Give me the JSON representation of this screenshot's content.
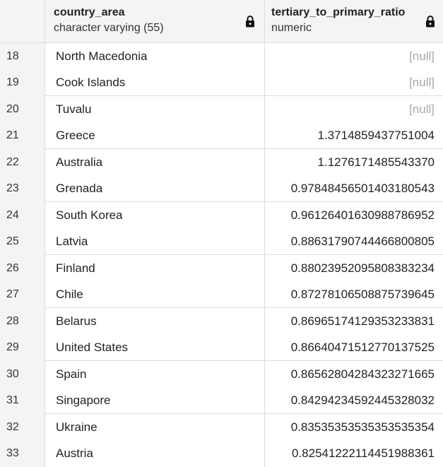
{
  "columns": [
    {
      "name": "country_area",
      "type": "character varying (55)",
      "icon": "lock-icon"
    },
    {
      "name": "tertiary_to_primary_ratio",
      "type": "numeric",
      "icon": "lock-icon"
    }
  ],
  "rows": [
    {
      "n": "18",
      "country": "North Macedonia",
      "ratio": "[null]",
      "is_null": true
    },
    {
      "n": "19",
      "country": "Cook Islands",
      "ratio": "[null]",
      "is_null": true
    },
    {
      "n": "20",
      "country": "Tuvalu",
      "ratio": "[null]",
      "is_null": true
    },
    {
      "n": "21",
      "country": "Greece",
      "ratio": "1.3714859437751004",
      "is_null": false
    },
    {
      "n": "22",
      "country": "Australia",
      "ratio": "1.1276171485543370",
      "is_null": false
    },
    {
      "n": "23",
      "country": "Grenada",
      "ratio": "0.97848456501403180543",
      "is_null": false
    },
    {
      "n": "24",
      "country": "South Korea",
      "ratio": "0.96126401630988786952",
      "is_null": false
    },
    {
      "n": "25",
      "country": "Latvia",
      "ratio": "0.88631790744466800805",
      "is_null": false
    },
    {
      "n": "26",
      "country": "Finland",
      "ratio": "0.88023952095808383234",
      "is_null": false
    },
    {
      "n": "27",
      "country": "Chile",
      "ratio": "0.87278106508875739645",
      "is_null": false
    },
    {
      "n": "28",
      "country": "Belarus",
      "ratio": "0.86965174129353233831",
      "is_null": false
    },
    {
      "n": "29",
      "country": "United States",
      "ratio": "0.86640471512770137525",
      "is_null": false
    },
    {
      "n": "30",
      "country": "Spain",
      "ratio": "0.86562804284323271665",
      "is_null": false
    },
    {
      "n": "31",
      "country": "Singapore",
      "ratio": "0.84294234592445328032",
      "is_null": false
    },
    {
      "n": "32",
      "country": "Ukraine",
      "ratio": "0.83535353535353535354",
      "is_null": false
    },
    {
      "n": "33",
      "country": "Austria",
      "ratio": "0.82541222114451988361",
      "is_null": false
    }
  ],
  "colors": {
    "header_bg": "#f4f4f4",
    "grid_line": "#dddddd",
    "null_text": "#a8a8a8"
  }
}
